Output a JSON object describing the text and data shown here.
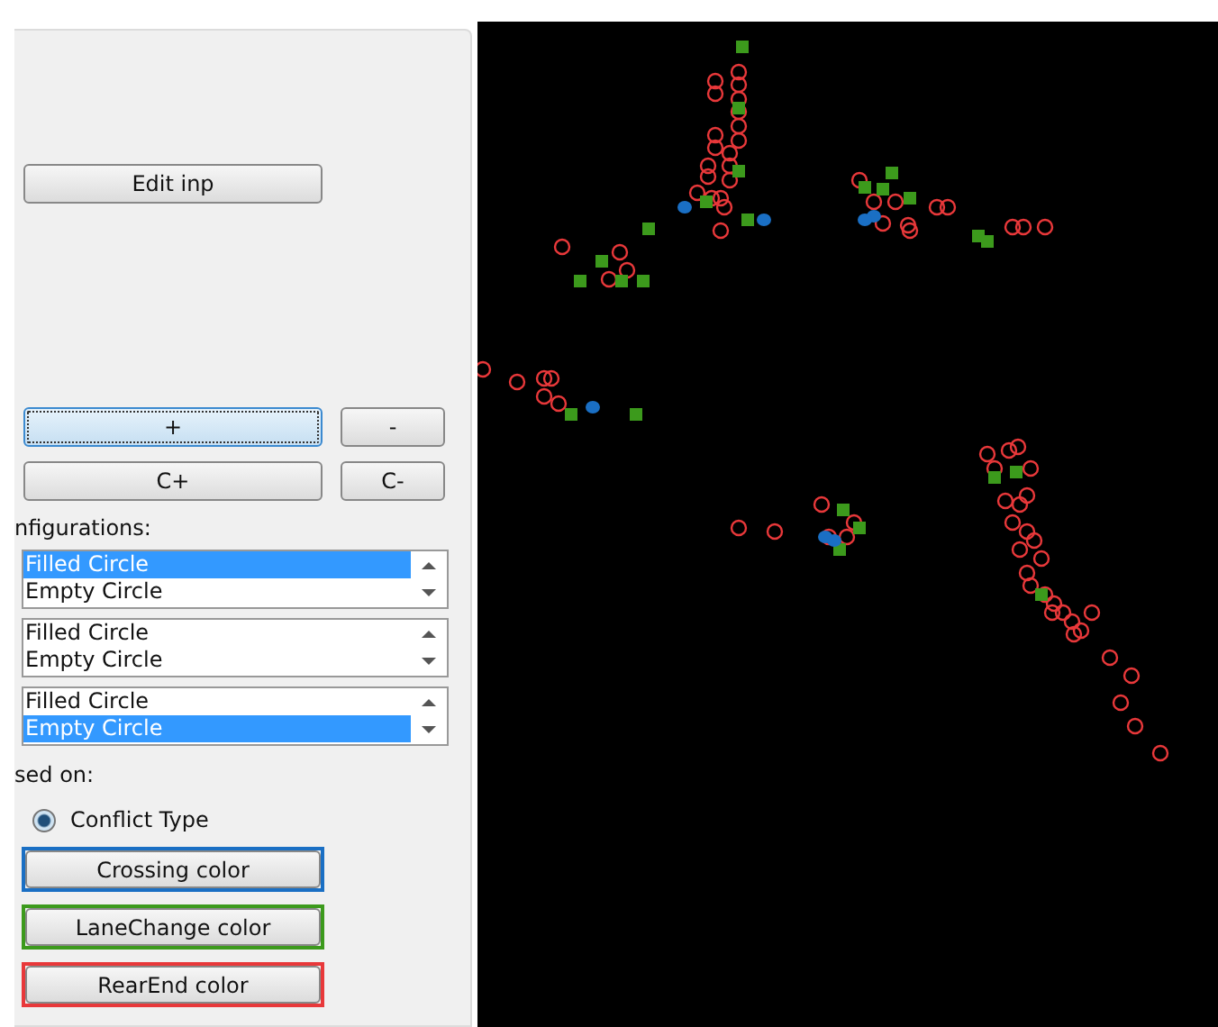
{
  "edit_button": "Edit inp",
  "point_buttons": [
    {
      "label": "+",
      "focused": true
    },
    {
      "label": "-",
      "focused": false
    }
  ],
  "cluster_buttons": [
    {
      "label": "C+"
    },
    {
      "label": "C-"
    }
  ],
  "configurations_label": "nfigurations:",
  "lists": [
    {
      "items": [
        {
          "label": "Filled Circle",
          "selected": true
        },
        {
          "label": "Empty Circle",
          "selected": false
        }
      ]
    },
    {
      "items": [
        {
          "label": "Filled Circle",
          "selected": false
        },
        {
          "label": "Empty Circle",
          "selected": false
        }
      ]
    },
    {
      "items": [
        {
          "label": "Filled Circle",
          "selected": false
        },
        {
          "label": "Empty Circle",
          "selected": true
        }
      ]
    }
  ],
  "based_on_label": "sed on:",
  "radio": {
    "label": "Conflict Type",
    "selected": true
  },
  "color_buttons": [
    {
      "label": "Crossing color",
      "color": "#1a6fc4"
    },
    {
      "label": "LaneChange color",
      "color": "#3c9a1c"
    },
    {
      "label": "RearEnd color",
      "color": "#e8383a"
    }
  ]
}
